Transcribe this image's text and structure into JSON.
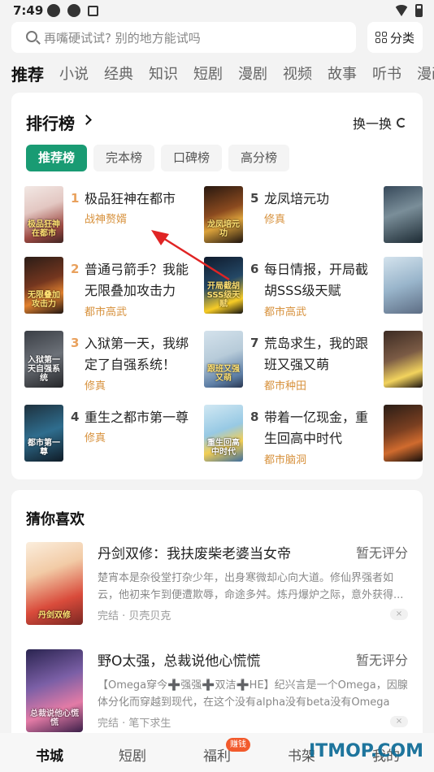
{
  "status_bar": {
    "time": "7:49"
  },
  "search": {
    "placeholder": "再嘴硬试试? 别的地方能试吗",
    "category_label": "分类"
  },
  "category_tabs": [
    "推荐",
    "小说",
    "经典",
    "知识",
    "短剧",
    "漫剧",
    "视频",
    "故事",
    "听书",
    "漫画"
  ],
  "ranking": {
    "title": "排行榜",
    "refresh_label": "换一换",
    "subtabs": [
      "推荐榜",
      "完本榜",
      "口碑榜",
      "高分榜"
    ],
    "items": [
      {
        "rank": "1",
        "title": "极品狂神在都市",
        "tag": "战神赘婿",
        "cover_text": "极品狂神在都市"
      },
      {
        "rank": "2",
        "title": "普通弓箭手？我能无限叠加攻击力",
        "tag": "都市高武",
        "cover_text": "无限叠加攻击力"
      },
      {
        "rank": "3",
        "title": "入狱第一天，我绑定了自强系统！",
        "tag": "修真",
        "cover_text": "入狱第一天自强系统"
      },
      {
        "rank": "4",
        "title": "重生之都市第一尊",
        "tag": "修真",
        "cover_text": "都市第一尊"
      },
      {
        "rank": "5",
        "title": "龙凤培元功",
        "tag": "修真",
        "cover_text": "龙凤培元功"
      },
      {
        "rank": "6",
        "title": "每日情报，开局截胡SSS级天赋",
        "tag": "都市高武",
        "cover_text": "开局截胡SSS级天赋"
      },
      {
        "rank": "7",
        "title": "荒岛求生，我的跟班又强又萌",
        "tag": "都市种田",
        "cover_text": "跟班又强又萌"
      },
      {
        "rank": "8",
        "title": "带着一亿现金，重生回高中时代",
        "tag": "都市脑洞",
        "cover_text": "重生回高中时代"
      }
    ]
  },
  "guess": {
    "title": "猜你喜欢",
    "books": [
      {
        "title": "丹剑双修：我扶废柴老婆当女帝",
        "score": "暂无评分",
        "desc": "楚宵本是杂役堂打杂少年，出身寒微却心向大道。修仙界强者如云，他初来乍到便遭欺辱，命途多舛。炼丹爆炉之际，意外获得...",
        "meta": "完结 · 贝壳贝克",
        "cover_text": "丹剑双修"
      },
      {
        "title": "野O太强，总裁说他心慌慌",
        "score": "暂无评分",
        "desc": "【Omega穿今➕强强➕双洁➕HE】纪兴言是一个Omega，因腺体分化而穿越到现代，在这个没有alpha没有beta没有Omega的...",
        "meta": "完结 · 笔下求生",
        "cover_text": "总裁说他心慌慌"
      }
    ]
  },
  "bottom_nav": {
    "items": [
      "书城",
      "短剧",
      "福利",
      "书架",
      "我的"
    ],
    "badge": "赚钱"
  },
  "watermark": "ITMOP.COM",
  "colors": {
    "accent": "#199b73",
    "tag": "#d7913c",
    "badge": "#f25a2c"
  }
}
